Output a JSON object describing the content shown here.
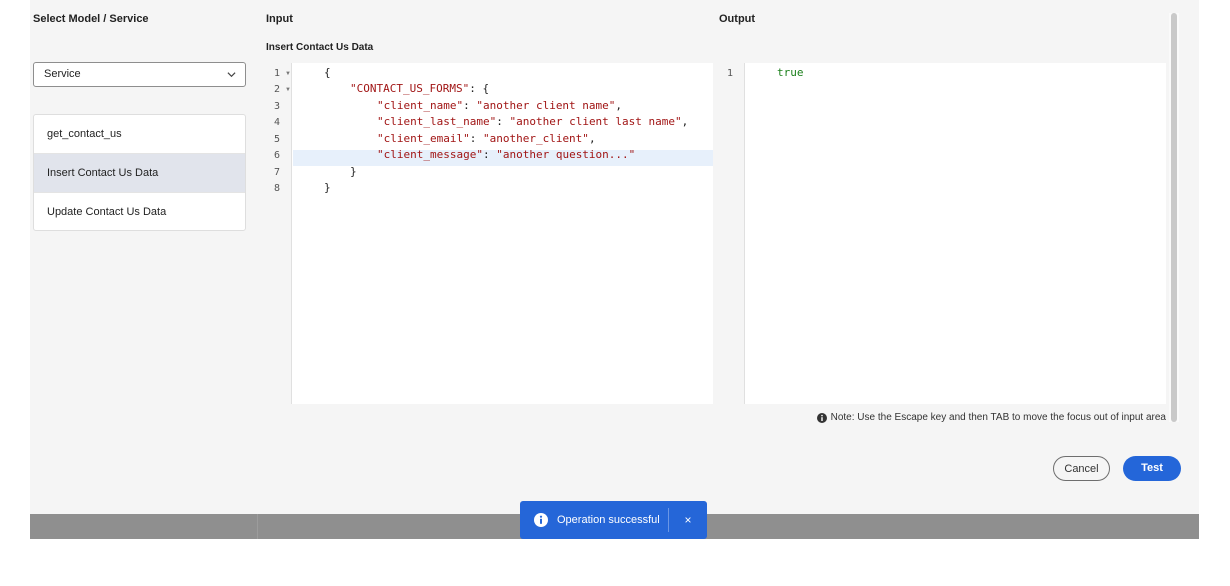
{
  "left": {
    "title": "Select Model / Service",
    "select_value": "Service",
    "operations": [
      {
        "label": "get_contact_us"
      },
      {
        "label": "Insert Contact Us Data"
      },
      {
        "label": "Update Contact Us Data"
      }
    ]
  },
  "input": {
    "title": "Input",
    "subtitle": "Insert Contact Us Data",
    "line_numbers": [
      "1",
      "2",
      "3",
      "4",
      "5",
      "6",
      "7",
      "8"
    ]
  },
  "output": {
    "title": "Output",
    "line_numbers": [
      "1"
    ],
    "value": "true"
  },
  "note": "Note: Use the Escape key and then TAB to move the focus out of input area",
  "buttons": {
    "cancel": "Cancel",
    "test": "Test"
  },
  "toast": {
    "message": "Operation successful",
    "close": "×"
  },
  "code": {
    "open_brace": "{",
    "forms_key": "\"CONTACT_US_FORMS\"",
    "client_name_key": "\"client_name\"",
    "client_name_val": "\"another client name\"",
    "client_last_name_key": "\"client_last_name\"",
    "client_last_name_val": "\"another client last name\"",
    "client_email_key": "\"client_email\"",
    "client_email_val": "\"another_client\"",
    "client_message_key": "\"client_message\"",
    "client_message_val": "\"another question...\"",
    "close_brace": "}"
  },
  "colors": {
    "primary": "#2466d9",
    "selected_row": "#e1e4ec",
    "json_string": "#a11515",
    "json_bool": "#1a7f1a"
  }
}
